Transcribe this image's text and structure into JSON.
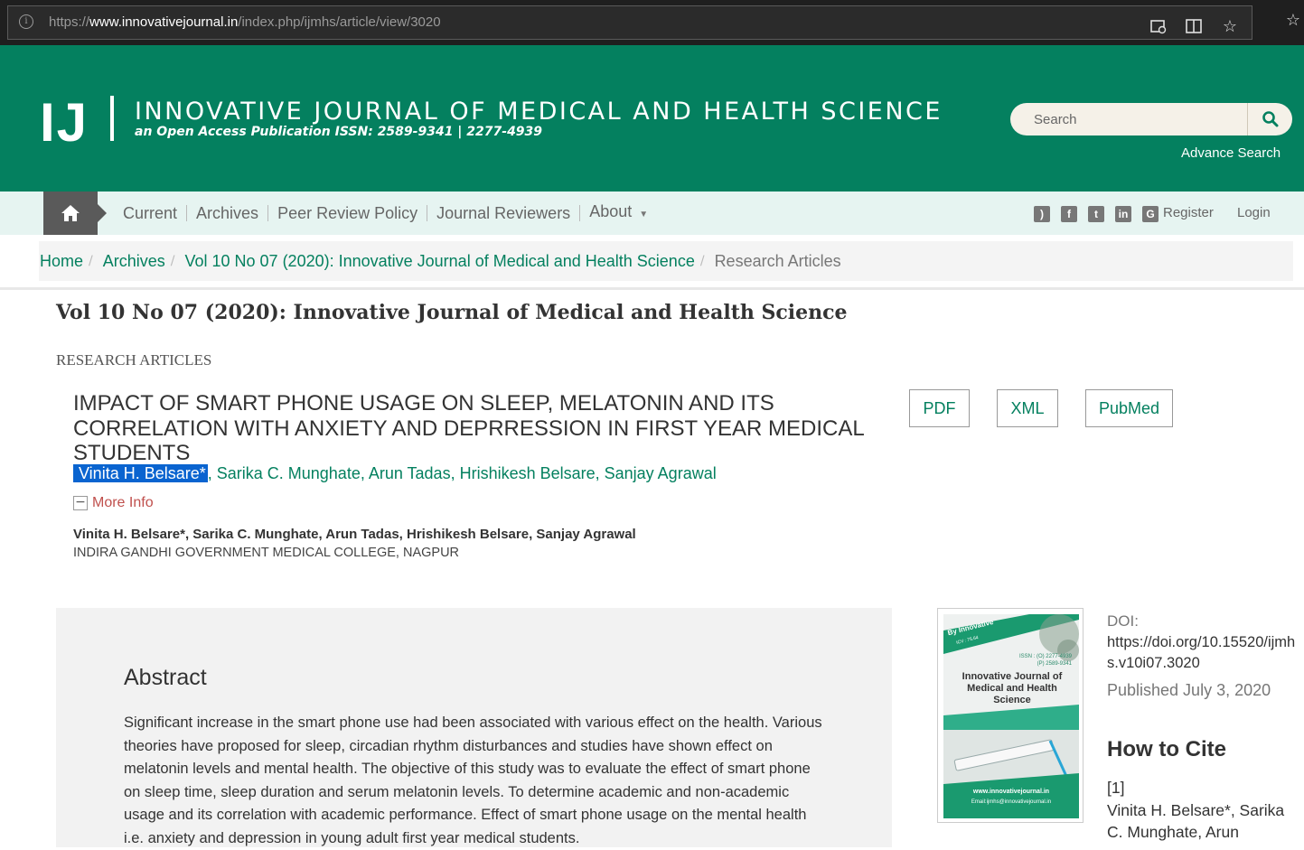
{
  "browser": {
    "url_prefix": "https://",
    "url_domain": "www.innovativejournal.in",
    "url_path": "/index.php/ijmhs/article/view/3020"
  },
  "header": {
    "logo": "IJ",
    "title": "INNOVATIVE JOURNAL OF MEDICAL AND HEALTH SCIENCE",
    "subtitle": "an Open Access Publication ISSN: 2589-9341 | 2277-4939",
    "search_placeholder": "Search",
    "advance_search": "Advance Search"
  },
  "nav": {
    "items": [
      "Current",
      "Archives",
      "Peer Review Policy",
      "Journal Reviewers",
      "About"
    ],
    "register": "Register",
    "login": "Login"
  },
  "breadcrumb": {
    "home": "Home",
    "archives": "Archives",
    "issue": "Vol 10 No 07 (2020): Innovative Journal of Medical and Health Science",
    "current": "Research Articles"
  },
  "article": {
    "issue_title": "Vol 10 No 07 (2020): Innovative Journal of Medical and Health Science",
    "section": "RESEARCH ARTICLES",
    "title": "IMPACT OF SMART PHONE USAGE ON SLEEP, MELATONIN AND ITS CORRELATION WITH ANXIETY AND DEPRRESSION IN FIRST YEAR MEDICAL STUDENTS",
    "selected_author": "Vinita H. Belsare*",
    "other_authors": ", Sarika C. Munghate, Arun Tadas, Hrishikesh Belsare, Sanjay Agrawal",
    "more_info": "More Info",
    "authors_bold": "Vinita H. Belsare*, Sarika C. Munghate, Arun Tadas, Hrishikesh Belsare, Sanjay Agrawal",
    "affiliation": "INDIRA GANDHI GOVERNMENT MEDICAL COLLEGE, NAGPUR",
    "galleys": {
      "pdf": "PDF",
      "xml": "XML",
      "pubmed": "PubMed"
    }
  },
  "abstract": {
    "heading": "Abstract",
    "text": "Significant increase in the smart phone use had been associated with various effect on the health. Various theories have proposed for sleep, circadian rhythm disturbances and studies have shown effect on melatonin levels and mental health. The objective of this study was to evaluate the effect of smart phone on sleep time, sleep duration and serum melatonin levels. To determine academic and non-academic usage and its correlation with academic performance. Effect of smart phone usage on the mental health i.e. anxiety and depression in young adult first year medical students."
  },
  "cover": {
    "brand": "By Innovative",
    "icv": "ICV : 75.64",
    "issn_o": "ISSN : (O) 2277-4939",
    "issn_p": "(P) 2589-9341",
    "title": "Innovative Journal of Medical and Health Science",
    "website": "www.innovativejournal.in",
    "email": "Email:ijmhs@innovativejournal.in"
  },
  "sidebar": {
    "doi_label": "DOI:",
    "doi": "https://doi.org/10.15520/ijmhs.v10i07.3020",
    "published": "Published July 3, 2020",
    "cite_heading": "How to Cite",
    "cite_number": "[1]",
    "cite_text": "Vinita H. Belsare*, Sarika C. Munghate, Arun"
  },
  "colors": {
    "brand_green": "#04805f",
    "selection": "#0a64d0",
    "more_info": "#c0504d"
  }
}
